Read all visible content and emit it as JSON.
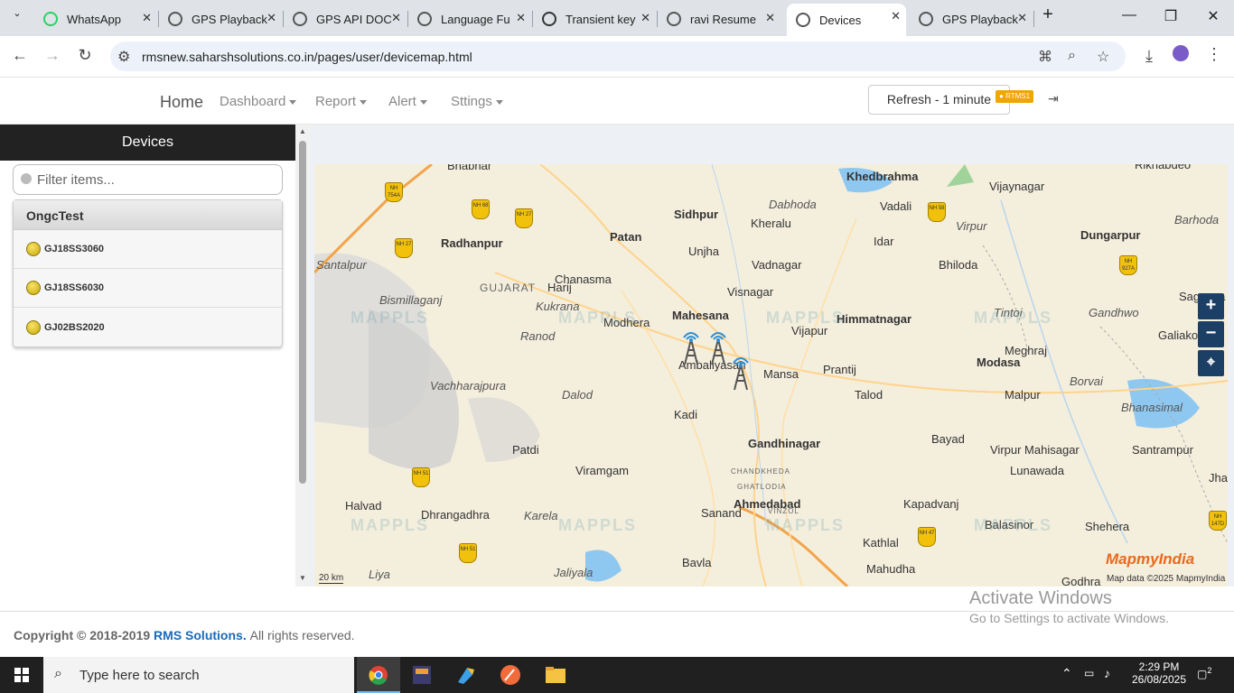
{
  "browser": {
    "tabs": [
      {
        "label": "WhatsApp",
        "icon": "whatsapp-icon",
        "color": "#25d366"
      },
      {
        "label": "GPS Playback",
        "icon": "globe-icon",
        "color": "#555555"
      },
      {
        "label": "GPS API DOC",
        "icon": "globe-icon",
        "color": "#555555"
      },
      {
        "label": "Language Fu",
        "icon": "globe-icon",
        "color": "#555555"
      },
      {
        "label": "Transient key",
        "icon": "openai-icon",
        "color": "#333333"
      },
      {
        "label": "ravi Resume",
        "icon": "globe-icon",
        "color": "#555555"
      },
      {
        "label": "Devices",
        "icon": "globe-icon",
        "color": "#555555"
      },
      {
        "label": "GPS Playback",
        "icon": "globe-icon",
        "color": "#555555"
      }
    ],
    "url": "rmsnew.saharshsolutions.co.in/pages/user/devicemap.html"
  },
  "nav": {
    "home": "Home",
    "dashboard": "Dashboard",
    "report": "Report",
    "alert": "Alert",
    "settings": "Sttings",
    "refresh": "Refresh - 1 minute",
    "user_badge": "RTMS1"
  },
  "sidebar": {
    "title": "Devices",
    "filter_placeholder": "Filter items...",
    "group": "OngcTest",
    "devices": [
      "GJ18SS3060",
      "GJ18SS6030",
      "GJ02BS2020"
    ]
  },
  "map": {
    "places": [
      {
        "name": "Bhabhar",
        "style": ""
      },
      {
        "name": "Khedbrahma",
        "style": "big"
      },
      {
        "name": "Vijaynagar",
        "style": ""
      },
      {
        "name": "Rikhabdeo",
        "style": ""
      },
      {
        "name": "Sidhpur",
        "style": "big"
      },
      {
        "name": "Dabhoda",
        "style": "it"
      },
      {
        "name": "Kheralu",
        "style": ""
      },
      {
        "name": "Vadali",
        "style": ""
      },
      {
        "name": "Virpur",
        "style": "it"
      },
      {
        "name": "Barhoda",
        "style": "it"
      },
      {
        "name": "Radhanpur",
        "style": "big"
      },
      {
        "name": "Patan",
        "style": "big"
      },
      {
        "name": "Unjha",
        "style": ""
      },
      {
        "name": "Idar",
        "style": ""
      },
      {
        "name": "Dungarpur",
        "style": "big"
      },
      {
        "name": "Santalpur",
        "style": "it"
      },
      {
        "name": "Chanasma",
        "style": ""
      },
      {
        "name": "Vadnagar",
        "style": ""
      },
      {
        "name": "Bhiloda",
        "style": ""
      },
      {
        "name": "GUJARAT",
        "style": "gujarat"
      },
      {
        "name": "Bismillaganj",
        "style": "it"
      },
      {
        "name": "Harij",
        "style": ""
      },
      {
        "name": "Visnagar",
        "style": ""
      },
      {
        "name": "Sagwara",
        "style": ""
      },
      {
        "name": "Kukrana",
        "style": "it"
      },
      {
        "name": "Mahesana",
        "style": "big"
      },
      {
        "name": "Himmatnagar",
        "style": "big"
      },
      {
        "name": "Tintoi",
        "style": "it"
      },
      {
        "name": "Gandhwo",
        "style": "it"
      },
      {
        "name": "Modhera",
        "style": ""
      },
      {
        "name": "Galiakot",
        "style": ""
      },
      {
        "name": "Ranod",
        "style": "it"
      },
      {
        "name": "Vijapur",
        "style": ""
      },
      {
        "name": "Meghraj",
        "style": ""
      },
      {
        "name": "Ambaliyasan",
        "style": ""
      },
      {
        "name": "Mansa",
        "style": ""
      },
      {
        "name": "Prantij",
        "style": ""
      },
      {
        "name": "Modasa",
        "style": "big"
      },
      {
        "name": "Vachharajpura",
        "style": "it"
      },
      {
        "name": "Talod",
        "style": ""
      },
      {
        "name": "Malpur",
        "style": ""
      },
      {
        "name": "Borvai",
        "style": "it"
      },
      {
        "name": "Dalod",
        "style": "it"
      },
      {
        "name": "Bhanasimal",
        "style": "it"
      },
      {
        "name": "Kadi",
        "style": ""
      },
      {
        "name": "Bayad",
        "style": ""
      },
      {
        "name": "Gandhinagar",
        "style": "big"
      },
      {
        "name": "Patdi",
        "style": ""
      },
      {
        "name": "Virpur Mahisagar",
        "style": ""
      },
      {
        "name": "Santrampur",
        "style": ""
      },
      {
        "name": "Viramgam",
        "style": ""
      },
      {
        "name": "CHANDKHEDA",
        "style": "gujarat"
      },
      {
        "name": "Lunawada",
        "style": ""
      },
      {
        "name": "Jhal",
        "style": ""
      },
      {
        "name": "GHATLODIA",
        "style": "gujarat"
      },
      {
        "name": "Halvad",
        "style": ""
      },
      {
        "name": "Ahmedabad",
        "style": "big"
      },
      {
        "name": "Kapadvanj",
        "style": ""
      },
      {
        "name": "Dhrangadhra",
        "style": ""
      },
      {
        "name": "Karela",
        "style": "it"
      },
      {
        "name": "Sanand",
        "style": ""
      },
      {
        "name": "VINZOL",
        "style": "gujarat"
      },
      {
        "name": "Balasinor",
        "style": ""
      },
      {
        "name": "Shehera",
        "style": ""
      },
      {
        "name": "Kathlal",
        "style": ""
      },
      {
        "name": "Bavla",
        "style": ""
      },
      {
        "name": "Mahudha",
        "style": ""
      },
      {
        "name": "Liya",
        "style": "it"
      },
      {
        "name": "Jaliyala",
        "style": "it"
      },
      {
        "name": "Godhra",
        "style": ""
      }
    ],
    "highway_shields": [
      "NH 754A",
      "NH 68",
      "NH 27",
      "NH 27",
      "NH 58",
      "NH 927A",
      "NH 51",
      "NH 51",
      "NH 47",
      "NH 147D"
    ],
    "watermark_top": "MAPPLS",
    "watermark_sub": "MapmyIndia",
    "logo": "MapmyIndia",
    "attribution": "Map data ©2025 MapmyIndia",
    "scale": "20 km",
    "zoom_in": "+",
    "zoom_out": "−"
  },
  "footer": {
    "prefix": "Copyright © 2018-2019",
    "brand": "RMS Solutions.",
    "suffix": "All rights reserved."
  },
  "activation": {
    "line1": "Activate Windows",
    "line2": "Go to Settings to activate Windows."
  },
  "taskbar": {
    "search_placeholder": "Type here to search",
    "time": "2:29 PM",
    "date": "26/08/2025",
    "notification_count": "2"
  }
}
